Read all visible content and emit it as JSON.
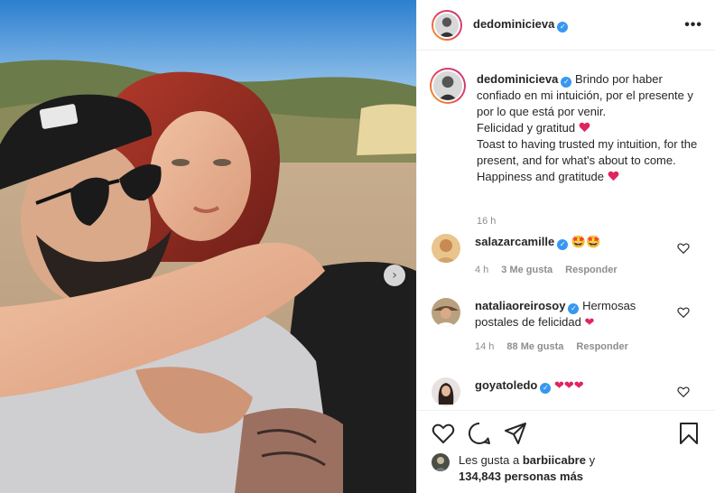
{
  "post": {
    "username": "dedominicieva",
    "verified": true,
    "more_icon": "more-horizontal-icon",
    "carousel_next_icon": "chevron-right-icon",
    "caption": {
      "username": "dedominicieva",
      "lines": [
        "Brindo por haber confiado en mi intuición, por el presente y por lo que está por venir.",
        "Felicidad y gratitud",
        "Toast to having trusted my intuition, for the present, and for what's about to come. Happiness and gratitude"
      ],
      "time": "16 h"
    },
    "comments": [
      {
        "username": "salazarcamille",
        "verified": true,
        "text": "",
        "emoji": "🤩🤩",
        "time": "4 h",
        "likes": "3 Me gusta",
        "reply": "Responder"
      },
      {
        "username": "nataliaoreirosoy",
        "verified": true,
        "text": "Hermosas postales de felicidad",
        "emoji": "❤",
        "time": "14 h",
        "likes": "88 Me gusta",
        "reply": "Responder"
      },
      {
        "username": "goyatoledo",
        "verified": true,
        "text": "",
        "emoji": "❤❤❤"
      }
    ],
    "likes": {
      "prefix": "Les gusta a",
      "user": "barbiicabre",
      "connector": "y",
      "count": "134,843 personas más"
    },
    "colors": {
      "heart": "#e0245e",
      "verified": "#3897f0",
      "muted": "#8e8e8e"
    }
  }
}
